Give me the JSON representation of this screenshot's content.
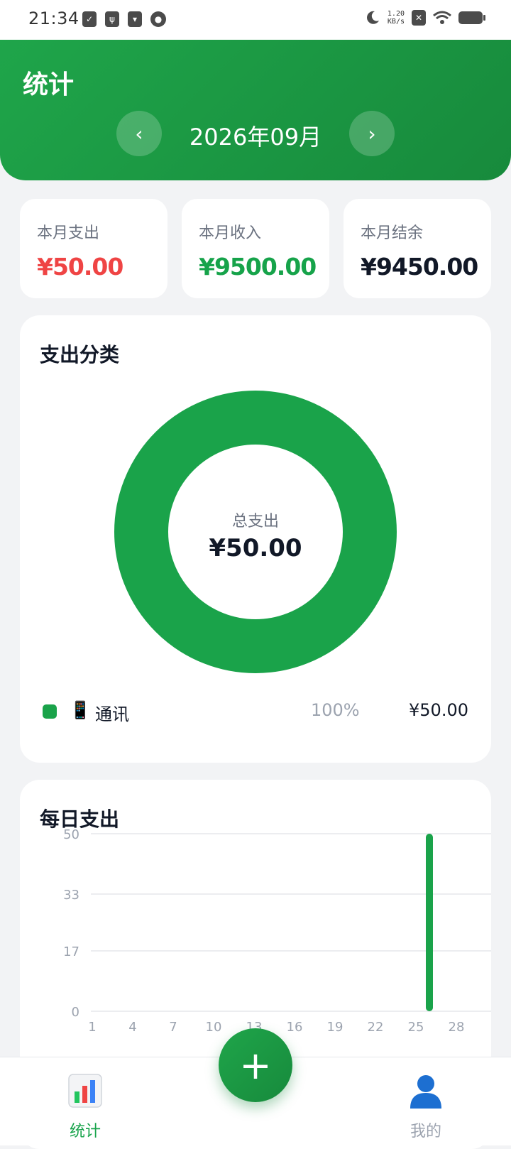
{
  "status_bar": {
    "time": "21:34",
    "net_speed_value": "1.20",
    "net_speed_unit": "KB/s"
  },
  "header": {
    "title": "统计",
    "month": "2026年09月",
    "prev_label": "‹",
    "next_label": "›"
  },
  "summary": [
    {
      "label": "本月支出",
      "value": "¥50.00",
      "color": "#ef4444"
    },
    {
      "label": "本月收入",
      "value": "¥9500.00",
      "color": "#16a34a"
    },
    {
      "label": "本月结余",
      "value": "¥9450.00",
      "color": "#111827"
    }
  ],
  "category": {
    "title": "支出分类",
    "center_label": "总支出",
    "center_value": "¥50.00",
    "items": [
      {
        "emoji": "📱",
        "name": "通讯",
        "percent": "100%",
        "amount": "¥50.00",
        "color": "#1aa34a",
        "fraction": 1.0
      }
    ]
  },
  "daily": {
    "title": "每日支出"
  },
  "chart_data": {
    "type": "bar",
    "x_ticks": [
      "1",
      "4",
      "7",
      "10",
      "13",
      "16",
      "19",
      "22",
      "25",
      "28"
    ],
    "y_ticks": [
      "50",
      "33",
      "17",
      "0"
    ],
    "ylim": [
      0,
      50
    ],
    "x": [
      26
    ],
    "values": [
      50
    ],
    "bar_color": "#1aa34a",
    "grid": true
  },
  "bottom_nav": {
    "fab_label": "+",
    "tabs": [
      {
        "label": "统计",
        "icon": "📊",
        "active": true
      },
      {
        "label": "我的",
        "icon": "👤",
        "active": false
      }
    ],
    "active_color": "#16a34a",
    "inactive_color": "#9ca3af"
  }
}
